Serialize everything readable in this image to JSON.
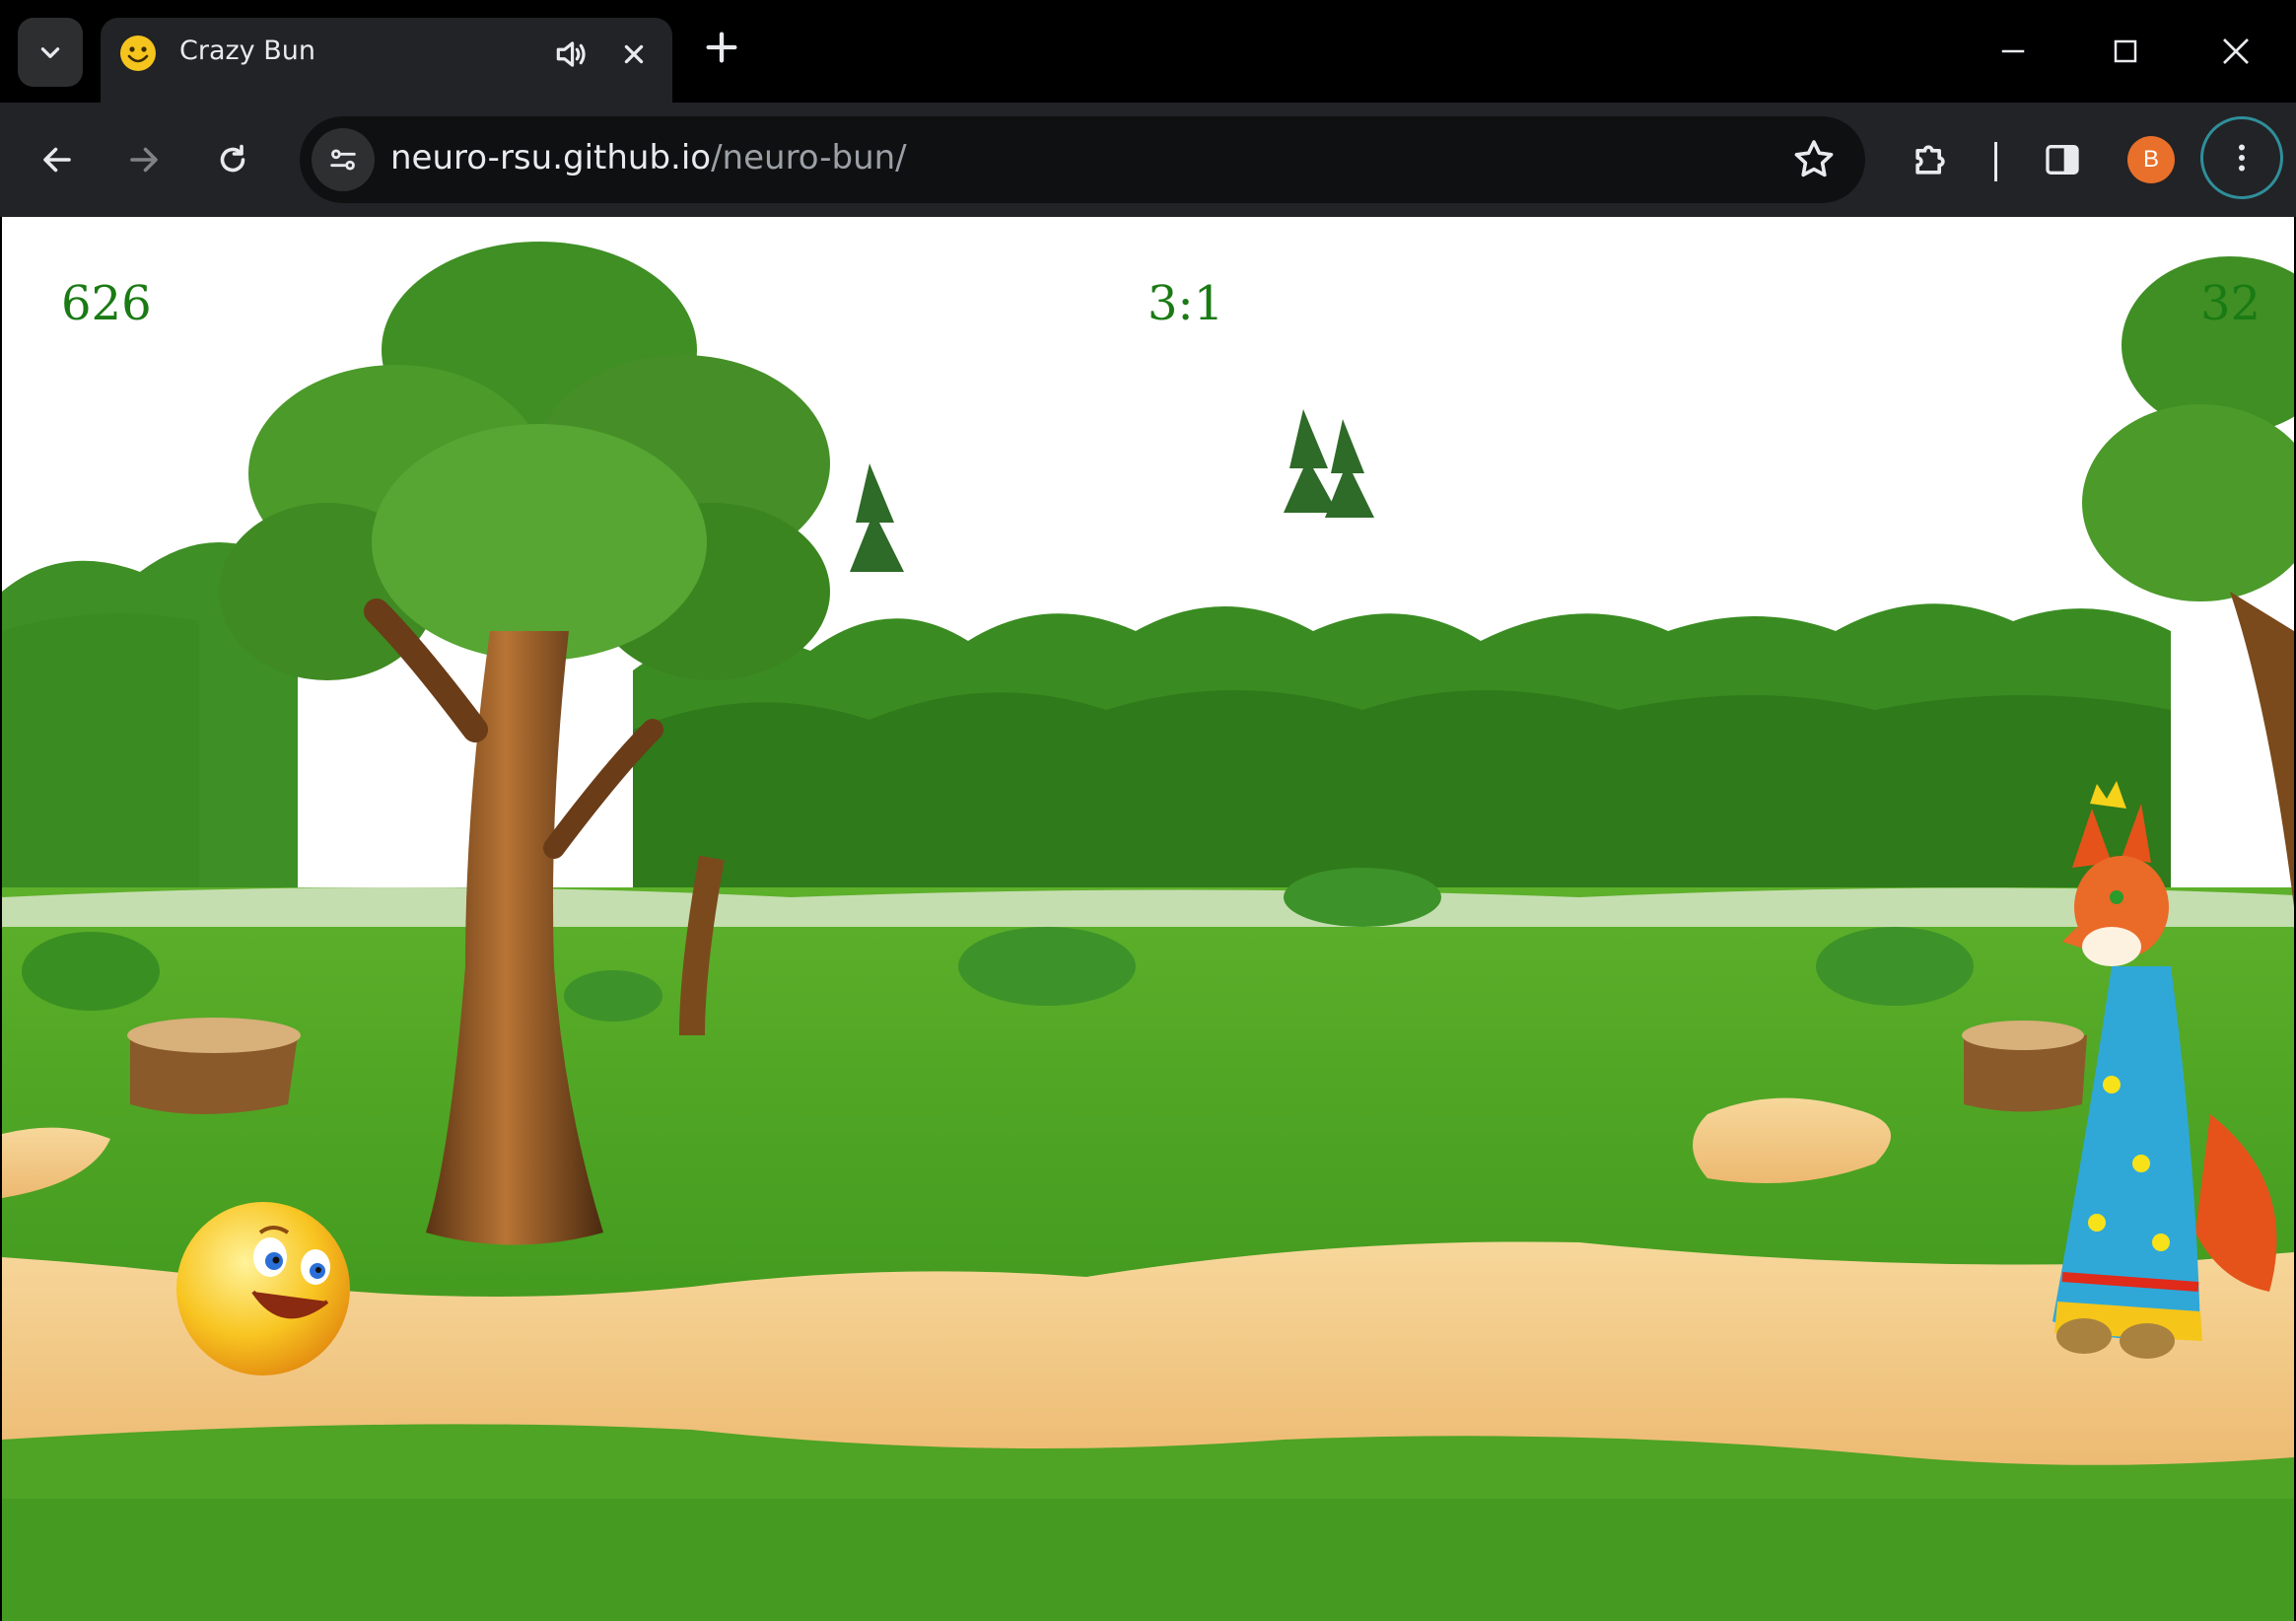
{
  "browser": {
    "tab": {
      "title": "Crazy Bun",
      "favicon": "smiley-icon",
      "audio_icon": "speaker-icon"
    },
    "address": {
      "host": "neuro-rsu.github.io",
      "path": "/neuro-bun/"
    },
    "profile_initial": "B",
    "colors": {
      "titlebar": "#000000",
      "toolbar": "#222326",
      "accent": "#2f8f9b",
      "avatar": "#e8702a"
    }
  },
  "game": {
    "hud": {
      "score": "626",
      "center": "3:1",
      "right": "32"
    },
    "characters": [
      "bun",
      "fox"
    ],
    "colors": {
      "hud_text": "#1a7a14",
      "grass": "#3e9a1f",
      "path": "#f3c784"
    }
  }
}
